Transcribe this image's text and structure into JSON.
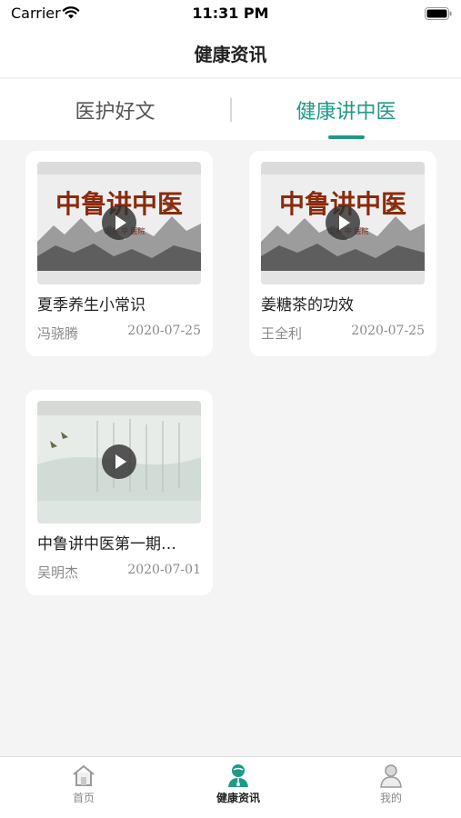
{
  "status_bar": {
    "carrier": "Carrier",
    "time": "11:31 PM"
  },
  "nav": {
    "title": "健康资讯"
  },
  "tabs": [
    {
      "label": "医护好文",
      "active": false
    },
    {
      "label": "健康讲中医",
      "active": true
    }
  ],
  "colors": {
    "accent": "#1f9a86",
    "background": "#f4f4f4"
  },
  "cards": [
    {
      "title": "夏季养生小常识",
      "author": "冯骁腾",
      "date": "2020-07-25",
      "thumb_title": "中鲁讲中医",
      "thumb_caption": "山东 中 医院"
    },
    {
      "title": "姜糖茶的功效",
      "author": "王全利",
      "date": "2020-07-25",
      "thumb_title": "中鲁讲中医",
      "thumb_caption": "山东 中 医院"
    },
    {
      "title": "中鲁讲中医第一期…",
      "author": "吴明杰",
      "date": "2020-07-01"
    }
  ],
  "bottom_tabs": [
    {
      "label": "首页",
      "icon": "home-icon"
    },
    {
      "label": "健康资讯",
      "icon": "doctor-icon",
      "active": true
    },
    {
      "label": "我的",
      "icon": "user-icon"
    }
  ]
}
